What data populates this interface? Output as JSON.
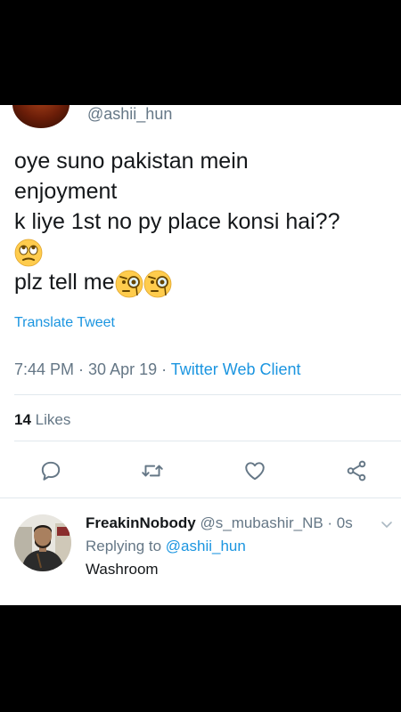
{
  "tweet": {
    "handle": "@ashii_hun",
    "lines": [
      "oye suno pakistan mein",
      "enjoyment",
      "k liye 1st no py place konsi hai??",
      "plz tell me"
    ],
    "translate_label": "Translate Tweet",
    "time": "7:44 PM",
    "date": "30 Apr 19",
    "source": "Twitter Web Client",
    "likes_count": "14",
    "likes_label": "Likes"
  },
  "reply": {
    "name": "FreakinNobody",
    "handle": "@s_mubashir_NB",
    "time": "0s",
    "replying_prefix": "Replying to",
    "replying_to": "@ashii_hun",
    "text": "Washroom"
  },
  "icons": {
    "reply": "reply-icon",
    "retweet": "retweet-icon",
    "like": "heart-icon",
    "share": "share-icon",
    "caret": "chevron-down-icon",
    "emojis": [
      "face-with-rolling-eyes-emoji",
      "face-with-monocle-emoji",
      "face-with-monocle-emoji"
    ]
  },
  "colors": {
    "text": "#14171a",
    "secondary": "#657786",
    "link": "#1b95e0",
    "divider": "#e1e8ed"
  }
}
